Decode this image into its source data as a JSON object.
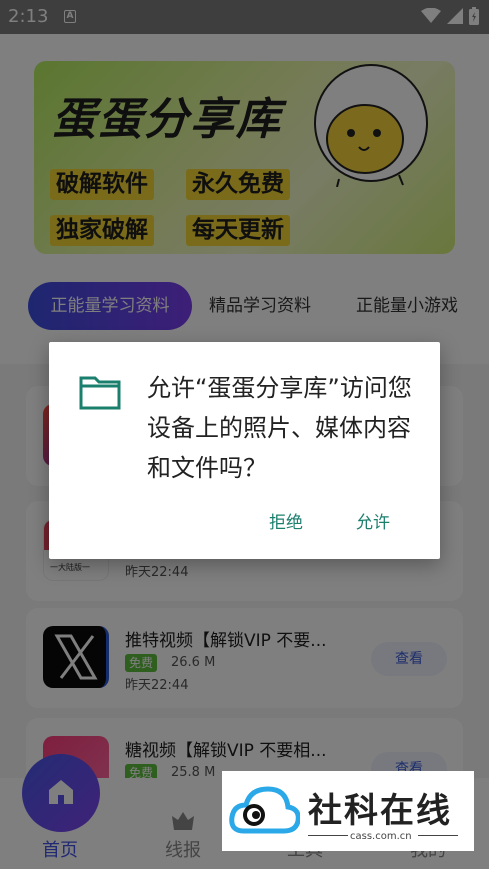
{
  "status_bar": {
    "time": "2:13"
  },
  "banner": {
    "title": "蛋蛋分享库",
    "tags": [
      "破解软件",
      "永久免费",
      "独家破解",
      "每天更新"
    ]
  },
  "tabs": [
    "正能量学习资料",
    "精品学习资料",
    "正能量小游戏"
  ],
  "cards": [
    {
      "name": "",
      "free": "",
      "size": "",
      "date": "",
      "view": ""
    },
    {
      "name": "",
      "free": "",
      "size": "",
      "date": "昨天22:44",
      "view": "",
      "icon_caption": "一大陆版一"
    },
    {
      "name": "推特视频【解锁VIP 不要...",
      "free": "免费",
      "size": "26.6 M",
      "date": "昨天22:44",
      "view": "查看"
    },
    {
      "name": "糖视频【解锁VIP 不要相...",
      "free": "免费",
      "size": "25.8 M",
      "date": "",
      "view": "查看"
    }
  ],
  "bottom_nav": [
    "首页",
    "线报",
    "工具",
    "我的"
  ],
  "dialog": {
    "message": "允许“蛋蛋分享库”访问您设备上的照片、媒体内容和文件吗？",
    "deny": "拒绝",
    "allow": "允许"
  },
  "watermark": {
    "text": "社科在线",
    "url": "cass.com.cn"
  },
  "colors": {
    "accent": "#4353e6",
    "dialog_button": "#1b7f6e",
    "free_badge": "#5fbf3e"
  }
}
